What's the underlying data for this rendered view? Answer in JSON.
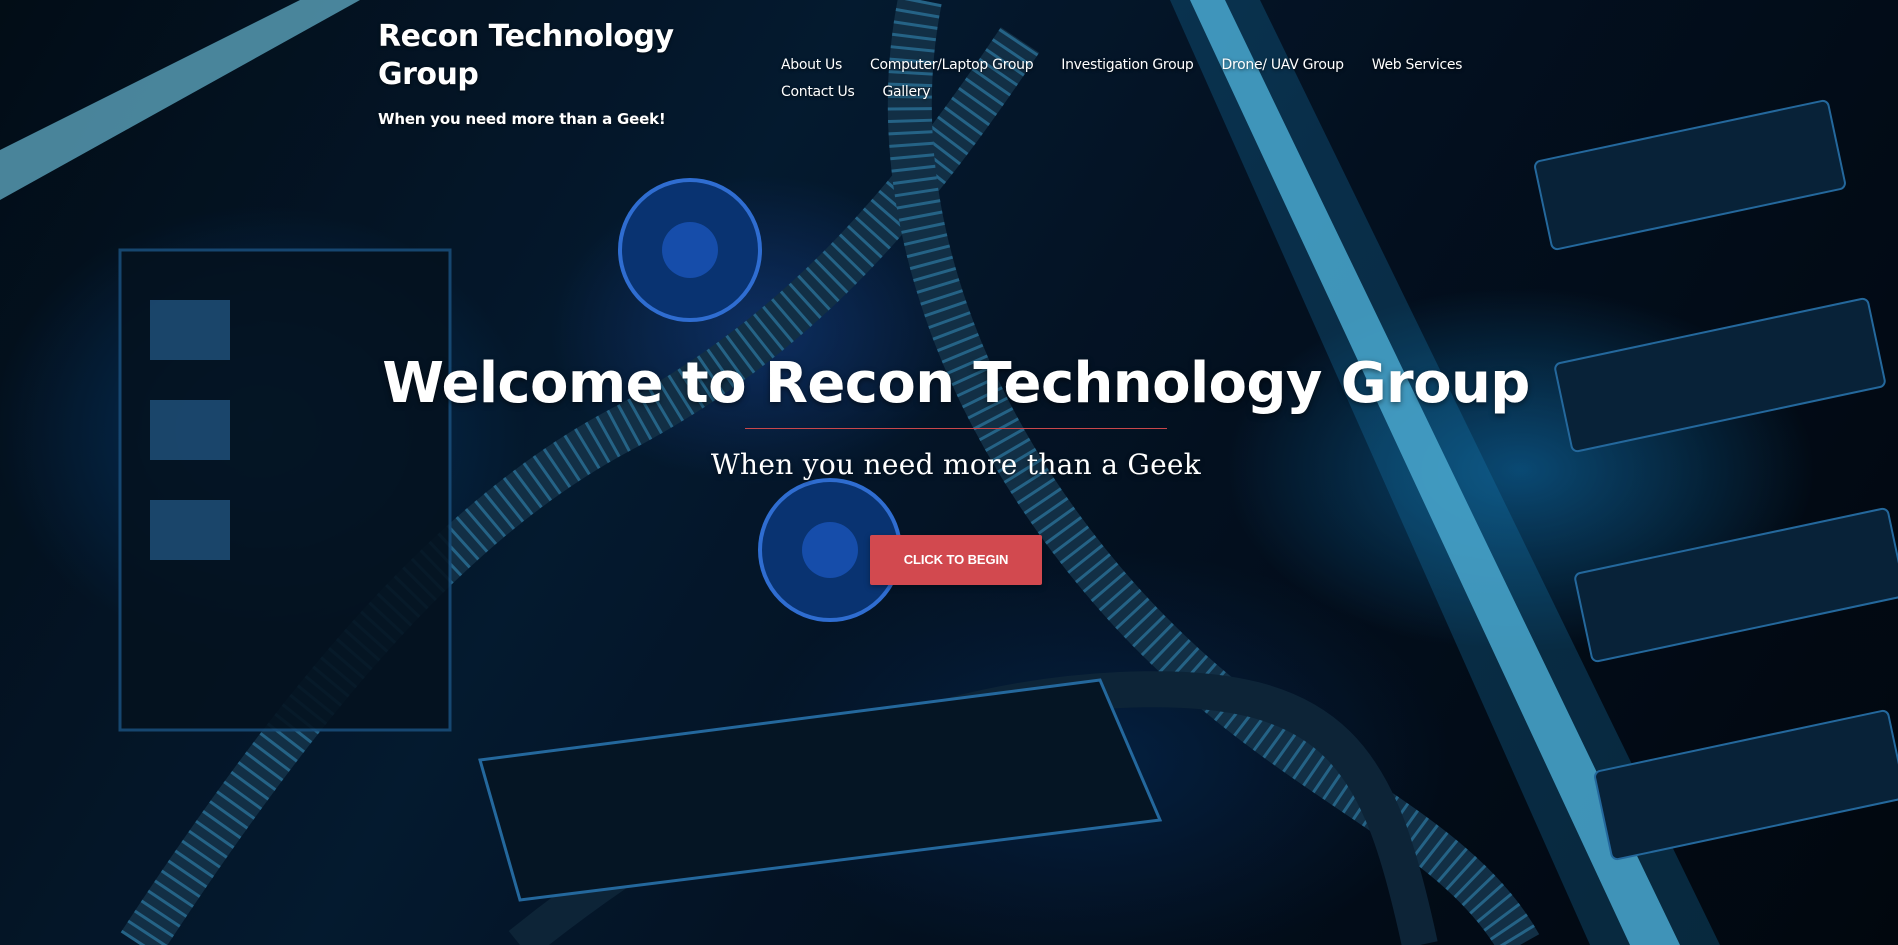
{
  "site": {
    "title": "Recon Technology Group",
    "tagline": "When you need more than a Geek!"
  },
  "nav": {
    "items": [
      {
        "label": "About Us"
      },
      {
        "label": "Computer/Laptop Group"
      },
      {
        "label": "Investigation Group"
      },
      {
        "label": "Drone/ UAV Group"
      },
      {
        "label": "Web Services"
      },
      {
        "label": "Contact Us"
      },
      {
        "label": "Gallery"
      }
    ]
  },
  "hero": {
    "heading": "Welcome to Recon Technology Group",
    "subheading": "When you need more than a Geek",
    "button_label": "CLICK TO BEGIN"
  },
  "colors": {
    "accent": "#d2494f",
    "divider": "#c9474b",
    "text": "#ffffff",
    "background_tint": "#06203a"
  }
}
